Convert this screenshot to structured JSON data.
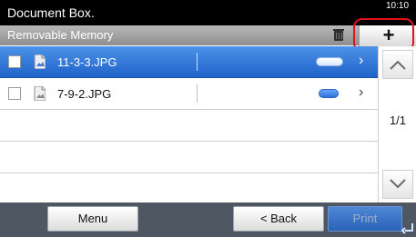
{
  "header": {
    "title": "Document Box.",
    "clock_text": "10:10",
    "subtitle": "Removable Memory"
  },
  "toolbar": {
    "add_label": "+",
    "icons": [
      "trash-icon",
      "plus-icon"
    ]
  },
  "files": [
    {
      "name": "11-3-3.JPG",
      "selected": true
    },
    {
      "name": "7-9-2.JPG",
      "selected": false
    }
  ],
  "pagination": {
    "page_text": "1/1"
  },
  "bottom_buttons": {
    "menu": "Menu",
    "back": "< Back",
    "print": "Print"
  },
  "colors": {
    "selected_row": "#1f63c9",
    "highlight_ring": "#e0121b",
    "bottom_bar": "#4f5862"
  }
}
